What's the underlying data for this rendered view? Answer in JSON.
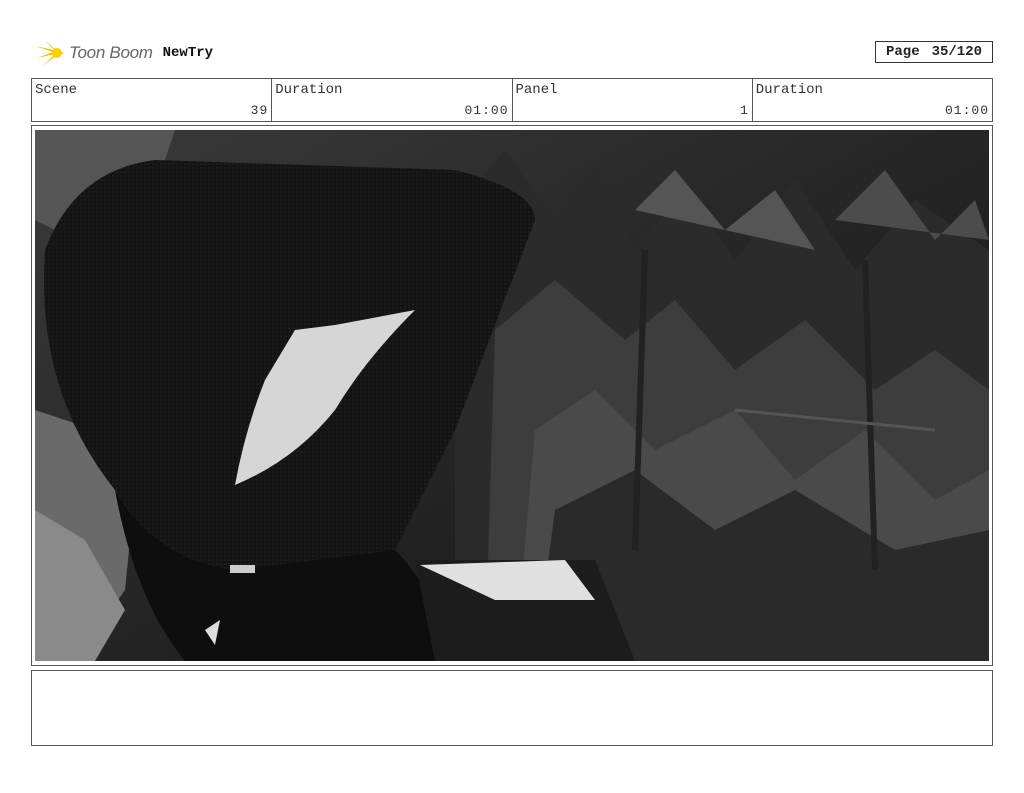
{
  "header": {
    "logo_text": "Toon Boom",
    "project_name": "NewTry",
    "page_label": "Page",
    "page_value": "35/120"
  },
  "info": {
    "scene_label": "Scene",
    "scene_value": "39",
    "duration_label": "Duration",
    "duration_value": "01:00",
    "panel_label": "Panel",
    "panel_value": "1",
    "panel_duration_label": "Duration",
    "panel_duration_value": "01:00"
  },
  "panel_image": {
    "icon": "storyboard-frame-image"
  },
  "colors": {
    "logo_yellow": "#f5c400",
    "border": "#555555"
  }
}
